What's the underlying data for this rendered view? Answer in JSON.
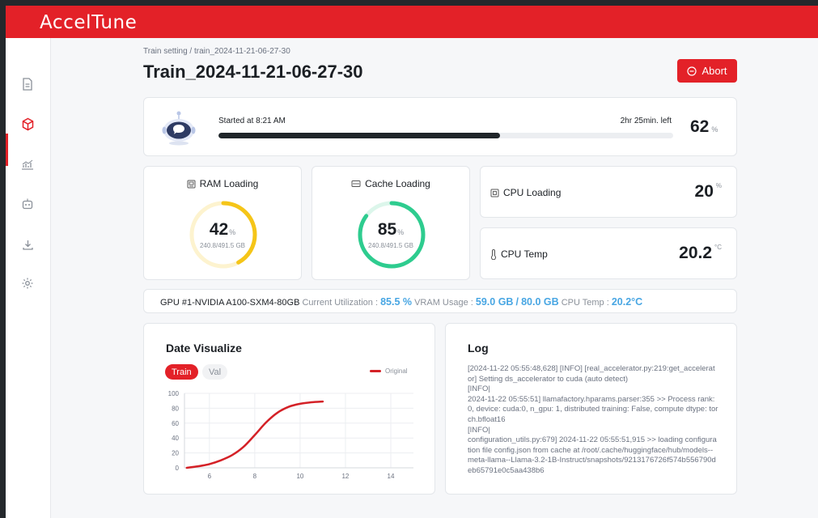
{
  "app": {
    "brand": "AccelTune"
  },
  "header": {
    "breadcrumb": "Train setting / train_2024-11-21-06-27-30",
    "title": "Train_2024-11-21-06-27-30",
    "abort_label": "Abort"
  },
  "sidebar": {
    "items": [
      {
        "icon": "document-icon"
      },
      {
        "icon": "cube-icon",
        "active": true
      },
      {
        "icon": "chart-icon"
      },
      {
        "icon": "robot-icon"
      },
      {
        "icon": "download-icon"
      },
      {
        "icon": "gear-icon"
      }
    ]
  },
  "progress": {
    "started": "Started at 8:21 AM",
    "time_left": "2hr 25min. left",
    "percent": 62,
    "percent_text": "62",
    "unit": "%"
  },
  "ram": {
    "title": "RAM Loading",
    "value": 42,
    "value_text": "42",
    "unit": "%",
    "detail": "240.8/491.5 GB"
  },
  "cache": {
    "title": "Cache Loading",
    "value": 85,
    "value_text": "85",
    "unit": "%",
    "detail": "240.8/491.5 GB"
  },
  "cpu_loading": {
    "label": "CPU Loading",
    "value": "20",
    "unit": "%"
  },
  "cpu_temp": {
    "label": "CPU Temp",
    "value": "20.2",
    "unit": "°C"
  },
  "gpu": {
    "name": "GPU #1-NVIDIA A100-SXM4-80GB",
    "util_label": "Current Utilization :",
    "util_value": "85.5 %",
    "vram_label": "VRAM Usage :",
    "vram_used": "59.0 GB",
    "vram_sep": "/",
    "vram_total": "80.0 GB",
    "temp_label": "CPU Temp :",
    "temp_value": "20.2°C"
  },
  "chart_section": {
    "title": "Date Visualize",
    "tabs": [
      "Train",
      "Val"
    ],
    "active_tab": "Train"
  },
  "colors": {
    "accent": "#e32128",
    "ram": "#f5c518",
    "cache": "#2ecc8f",
    "gpu_value": "#48a6e3"
  },
  "chart_data": {
    "type": "line",
    "title": "",
    "xlabel": "",
    "ylabel": "",
    "xlim": [
      4.9,
      15
    ],
    "ylim": [
      0,
      100
    ],
    "xticks": [
      6,
      8,
      10,
      12,
      14
    ],
    "yticks": [
      0,
      20,
      40,
      60,
      80,
      100
    ],
    "grid": true,
    "legend": "top-right",
    "series": [
      {
        "name": "Original",
        "color": "#d42127",
        "x": [
          5,
          5.5,
          6,
          6.5,
          7,
          7.5,
          8,
          8.5,
          9,
          9.5,
          10,
          10.5,
          11
        ],
        "y": [
          0,
          2,
          5,
          10,
          17,
          28,
          44,
          61,
          74,
          82,
          86,
          88,
          89
        ]
      }
    ]
  },
  "log": {
    "title": "Log",
    "lines": [
      "[2024-11-22 05:55:48,628] [INFO] [real_accelerator.py:219:get_accelerator] Setting ds_accelerator to cuda (auto detect)",
      "[INFO|",
      "2024-11-22 05:55:51] llamafactory.hparams.parser:355 >> Process rank: 0, device: cuda:0, n_gpu: 1, distributed training: False, compute dtype: torch.bfloat16",
      "[INFO|",
      "configuration_utils.py:679] 2024-11-22 05:55:51,915 >> loading configuration file config.json from cache at /root/.cache/huggingface/hub/models--meta-llama--Llama-3.2-1B-Instruct/snapshots/9213176726f574b556790deb65791e0c5aa438b6"
    ]
  }
}
